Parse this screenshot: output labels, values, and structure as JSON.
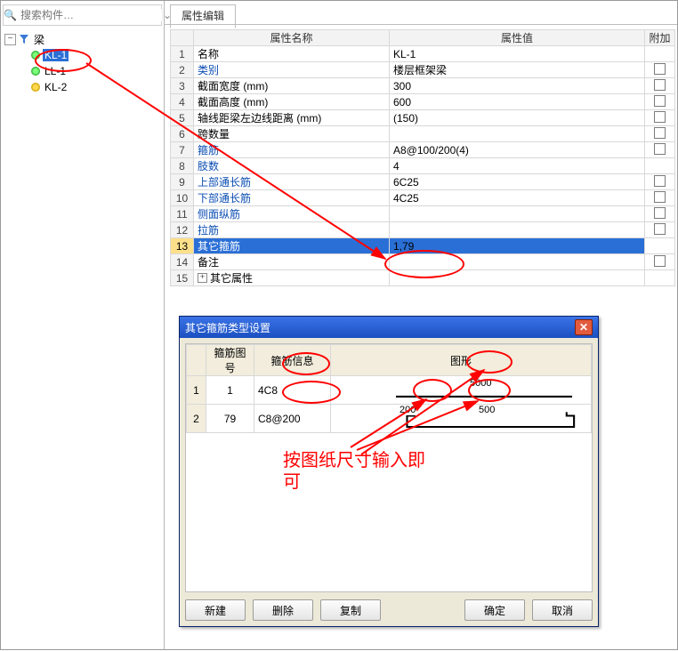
{
  "search": {
    "placeholder": "搜索构件…"
  },
  "tree": {
    "root": "梁",
    "items": [
      {
        "label": "KL-1",
        "gear": "green",
        "selected": true
      },
      {
        "label": "LL-1",
        "gear": "green",
        "selected": false
      },
      {
        "label": "KL-2",
        "gear": "yellow",
        "selected": false
      }
    ]
  },
  "tab": {
    "label": "属性编辑"
  },
  "grid": {
    "headers": {
      "name": "属性名称",
      "value": "属性值",
      "extra": "附加"
    },
    "rows": [
      {
        "n": "1",
        "name": "名称",
        "black": true,
        "value": "KL-1",
        "att": false
      },
      {
        "n": "2",
        "name": "类别",
        "value": "楼层框架梁",
        "att": true
      },
      {
        "n": "3",
        "name": "截面宽度 (mm)",
        "black": true,
        "value": "300",
        "att": true
      },
      {
        "n": "4",
        "name": "截面高度 (mm)",
        "black": true,
        "value": "600",
        "att": true
      },
      {
        "n": "5",
        "name": "轴线距梁左边线距离 (mm)",
        "black": true,
        "value": "(150)",
        "att": true
      },
      {
        "n": "6",
        "name": "跨数量",
        "black": true,
        "value": "",
        "att": true
      },
      {
        "n": "7",
        "name": "箍筋",
        "value": "A8@100/200(4)",
        "att": true
      },
      {
        "n": "8",
        "name": "肢数",
        "value": "4",
        "att": false
      },
      {
        "n": "9",
        "name": "上部通长筋",
        "value": "6C25",
        "att": true
      },
      {
        "n": "10",
        "name": "下部通长筋",
        "value": "4C25",
        "att": true
      },
      {
        "n": "11",
        "name": "侧面纵筋",
        "value": "",
        "att": true
      },
      {
        "n": "12",
        "name": "拉筋",
        "value": "",
        "att": true
      },
      {
        "n": "13",
        "name": "其它箍筋",
        "value": "1,79",
        "att": false,
        "selected": true
      },
      {
        "n": "14",
        "name": "备注",
        "black": true,
        "value": "",
        "att": true
      },
      {
        "n": "15",
        "name": "其它属性",
        "black": true,
        "expand": true,
        "att": false
      }
    ]
  },
  "dialog": {
    "title": "其它箍筋类型设置",
    "headers": {
      "no": "箍筋图号",
      "info": "箍筋信息",
      "shape": "图形"
    },
    "rows": [
      {
        "rn": "1",
        "no": "1",
        "info": "4C8",
        "shape": "bar",
        "v1": "5000"
      },
      {
        "rn": "2",
        "no": "79",
        "info": "C8@200",
        "shape": "stir",
        "v1": "200",
        "v2": "500"
      }
    ],
    "buttons": {
      "new": "新建",
      "del": "删除",
      "copy": "复制",
      "ok": "确定",
      "cancel": "取消"
    }
  },
  "note": {
    "line1": "按图纸尺寸输入即",
    "line2": "可"
  }
}
